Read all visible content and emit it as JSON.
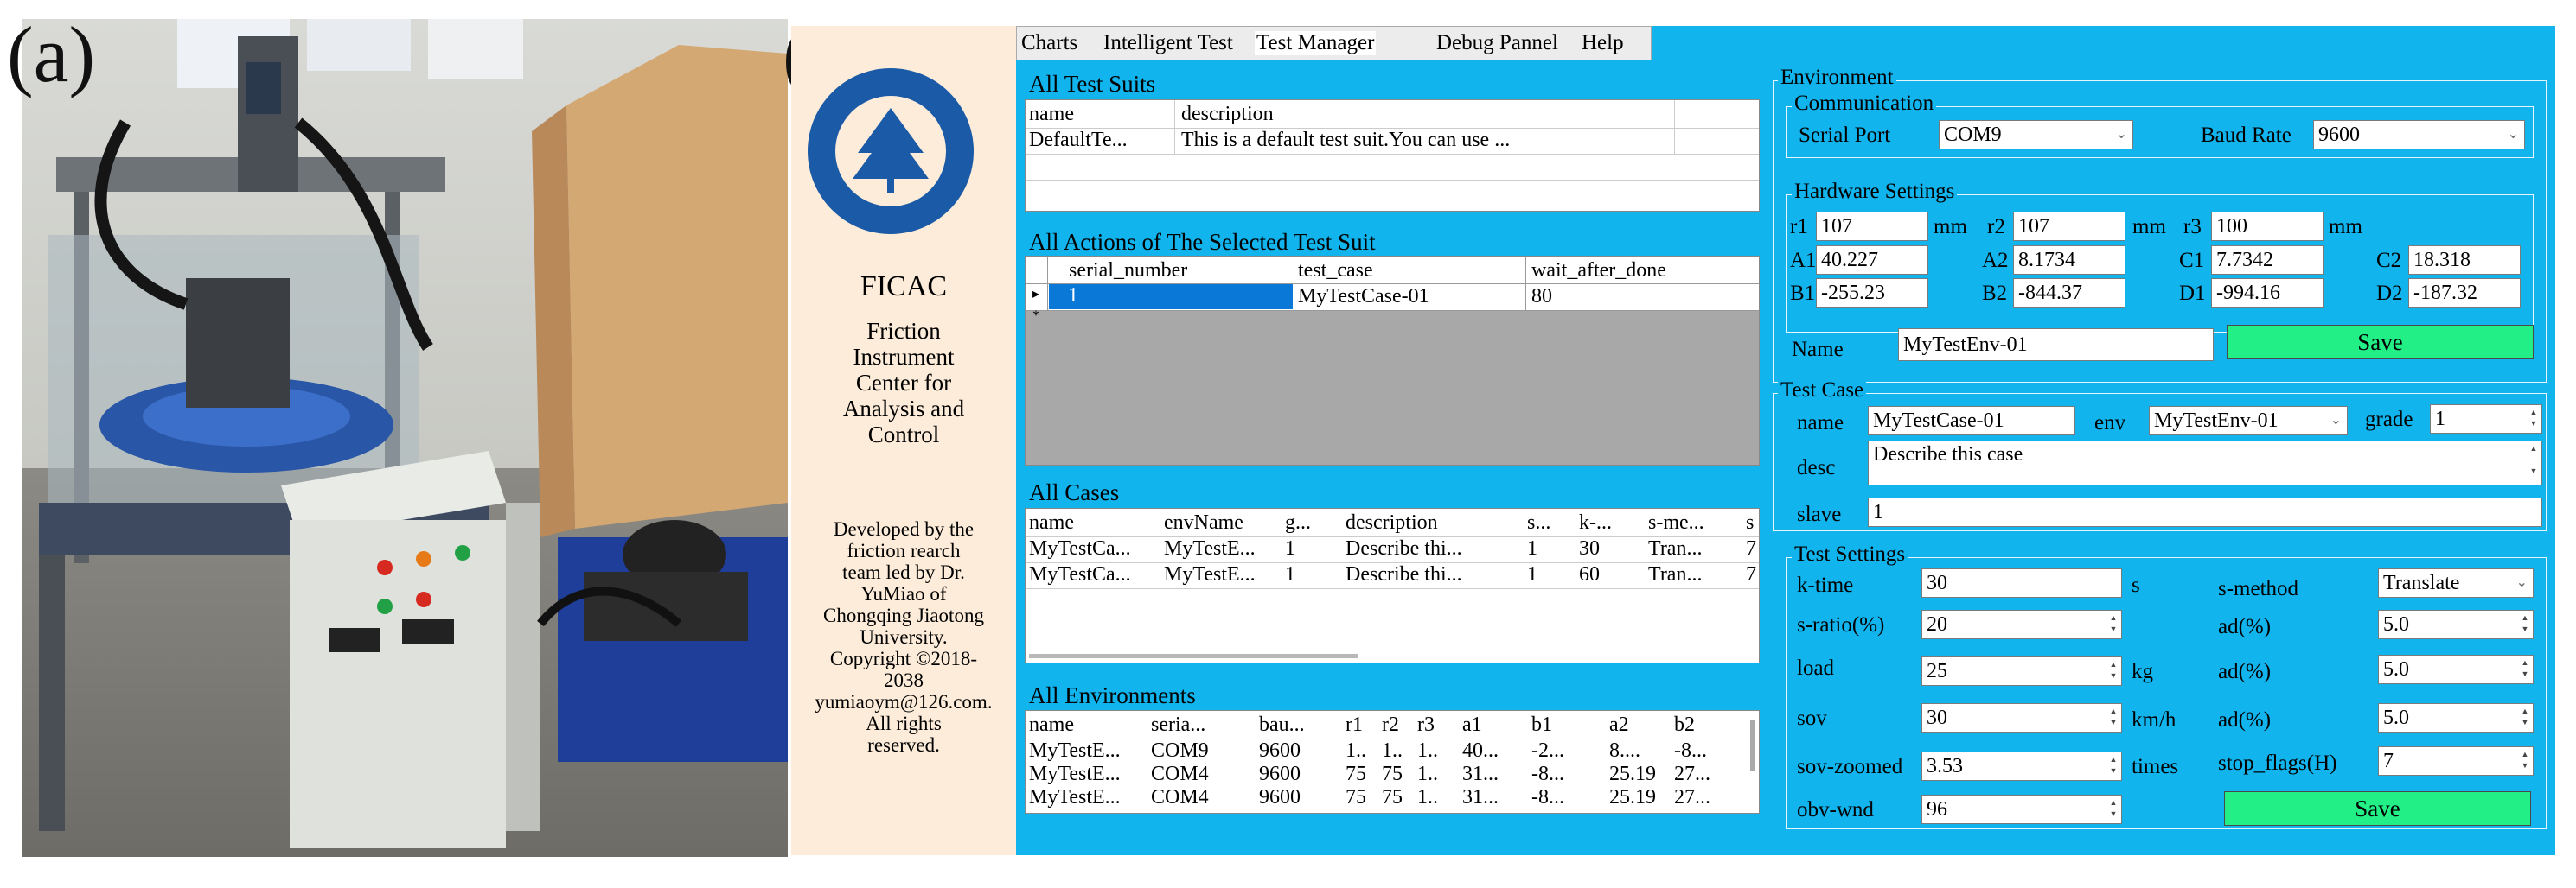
{
  "panel_labels": {
    "a": "(a)",
    "b": "(b)"
  },
  "sidebar": {
    "title": "FICAC",
    "subtitle_lines": [
      "Friction",
      "Instrument",
      "Center for",
      "Analysis and",
      "Control"
    ],
    "credits_lines": [
      "Developed by the",
      "friction rearch",
      "team led by Dr.",
      "YuMiao of",
      "Chongqing Jiaotong",
      "University.",
      "Copyright ©2018-",
      "2038",
      "yumiaoym@126.com.",
      "All rights",
      "reserved."
    ]
  },
  "menu": {
    "items": [
      "Charts",
      "Intelligent Test",
      "Test Manager",
      "Debug Pannel",
      "Help"
    ]
  },
  "suits": {
    "title": "All Test Suits",
    "headers": [
      "name",
      "description"
    ],
    "rows": [
      [
        "DefaultTe...",
        "This is a default test suit.You can use ..."
      ]
    ]
  },
  "actions": {
    "title": "All Actions of The Selected Test Suit",
    "headers": [
      "serial_number",
      "test_case",
      "wait_after_done"
    ],
    "rows": [
      [
        "1",
        "MyTestCase-01",
        "80"
      ]
    ],
    "row_markers": [
      "▸",
      "*"
    ]
  },
  "cases": {
    "title": "All Cases",
    "headers": [
      "name",
      "envName",
      "g...",
      "description",
      "s...",
      "k-...",
      "s-me...",
      "s"
    ],
    "rows": [
      [
        "MyTestCa...",
        "MyTestE...",
        "1",
        "Describe thi...",
        "1",
        "30",
        "Tran...",
        "7"
      ],
      [
        "MyTestCa...",
        "MyTestE...",
        "1",
        "Describe thi...",
        "1",
        "60",
        "Tran...",
        "7"
      ]
    ]
  },
  "envs": {
    "title": "All Environments",
    "headers": [
      "name",
      "seria...",
      "bau...",
      "r1",
      "r2",
      "r3",
      "a1",
      "b1",
      "a2",
      "b2"
    ],
    "rows": [
      [
        "MyTestE...",
        "COM9",
        "9600",
        "1..",
        "1..",
        "1..",
        "40...",
        "-2...",
        "8....",
        "-8..."
      ],
      [
        "MyTestE...",
        "COM4",
        "9600",
        "75",
        "75",
        "1..",
        "31...",
        "-8...",
        "25.19",
        "27..."
      ],
      [
        "MyTestE...",
        "COM4",
        "9600",
        "75",
        "75",
        "1..",
        "31...",
        "-8...",
        "25.19",
        "27..."
      ]
    ]
  },
  "environment": {
    "title": "Environment",
    "communication_title": "Communication",
    "serial_port_label": "Serial Port",
    "serial_port": "COM9",
    "baud_rate_label": "Baud Rate",
    "baud_rate": "9600",
    "hardware_title": "Hardware Settings",
    "r1_label": "r1",
    "r1": "107",
    "r2_label": "r2",
    "r2": "107",
    "r3_label": "r3",
    "r3": "100",
    "mm": "mm",
    "A1_label": "A1",
    "A1": "40.227",
    "A2_label": "A2",
    "A2": "8.1734",
    "C1_label": "C1",
    "C1": "7.7342",
    "C2_label": "C2",
    "C2": "18.318",
    "B1_label": "B1",
    "B1": "-255.23",
    "B2_label": "B2",
    "B2": "-844.37",
    "D1_label": "D1",
    "D1": "-994.16",
    "D2_label": "D2",
    "D2": "-187.32",
    "name_label": "Name",
    "name": "MyTestEnv-01",
    "save_label": "Save"
  },
  "test_case": {
    "title": "Test Case",
    "name_label": "name",
    "name": "MyTestCase-01",
    "env_label": "env",
    "env": "MyTestEnv-01",
    "grade_label": "grade",
    "grade": "1",
    "desc_label": "desc",
    "desc": "Describe this case",
    "slave_label": "slave",
    "slave": "1"
  },
  "test_settings": {
    "title": "Test Settings",
    "ktime_label": "k-time",
    "ktime": "30",
    "ktime_unit": "s",
    "sratio_label": "s-ratio(%)",
    "sratio": "20",
    "load_label": "load",
    "load": "25",
    "load_unit": "kg",
    "sov_label": "sov",
    "sov": "30",
    "sov_unit": "km/h",
    "sovz_label": "sov-zoomed",
    "sovz": "3.53",
    "sovz_unit": "times",
    "obv_label": "obv-wnd",
    "obv": "96",
    "smethod_label": "s-method",
    "smethod": "Translate",
    "ad_label": "ad(%)",
    "ad1": "5.0",
    "ad2": "5.0",
    "ad3": "5.0",
    "stop_label": "stop_flags(H)",
    "stop": "7",
    "save_label": "Save"
  },
  "colors": {
    "app_bg": "#12b4ee",
    "save_button": "#22f087",
    "sidebar_bg": "#fdecd9"
  }
}
